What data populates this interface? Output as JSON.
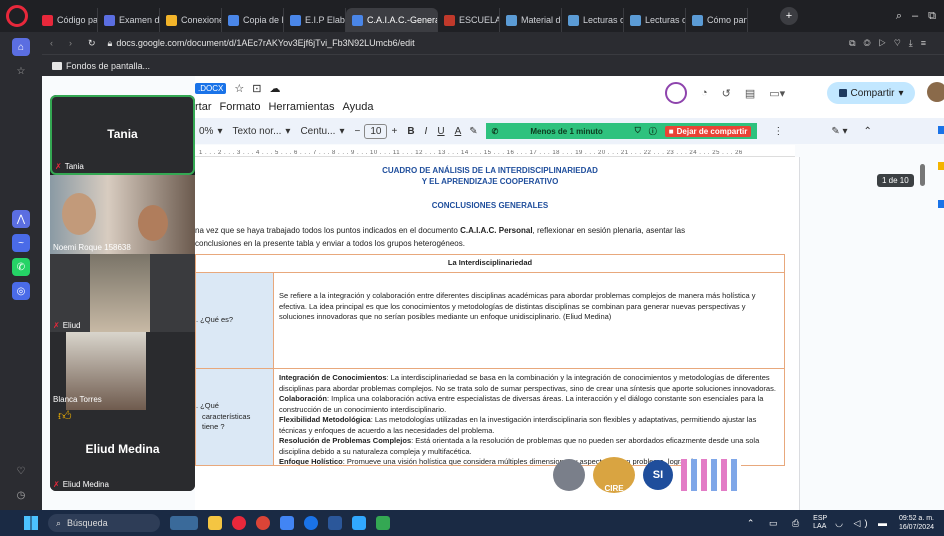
{
  "browser": {
    "tabs": [
      {
        "label": "Código para i",
        "color": "#e8283b"
      },
      {
        "label": "Examen de 2°",
        "color": "#5b6ee1"
      },
      {
        "label": "Conexiones 5°",
        "color": "#f2b42a"
      },
      {
        "label": "Copia de Roq",
        "color": "#4a86e8"
      },
      {
        "label": "E.I.P Elaborac",
        "color": "#4a86e8"
      },
      {
        "label": "C.A.I.A.C.-General.docx",
        "color": "#4a86e8"
      },
      {
        "label": "ESCUELA BEN",
        "color": "#c0392b"
      },
      {
        "label": "Material de ap",
        "color": "#5b9bd5"
      },
      {
        "label": "Lecturas oblig",
        "color": "#5b9bd5"
      },
      {
        "label": "Lecturas oblig",
        "color": "#5b9bd5"
      },
      {
        "label": "Cómo particip",
        "color": "#5b9bd5"
      }
    ],
    "url": "docs.google.com/document/d/1AEc7rAKYov3Ejf6jTvi_Fb3N92LUmcb6/edit",
    "bookmark": "Fondos de pantalla..."
  },
  "doc": {
    "file_badge": ".DOCX",
    "menu": [
      "rtar",
      "Formato",
      "Herramientas",
      "Ayuda"
    ],
    "toolbar": {
      "zoom": "0%",
      "style": "Texto nor...",
      "font": "Centu...",
      "size": "10",
      "bold": "B",
      "italic": "I",
      "underline": "U",
      "color": "A",
      "meet_time": "Menos de 1 minuto",
      "stop_share": "Dejar de compartir",
      "share": "Compartir"
    },
    "ruler_text": "1 . . . 2 . . . 3 . . . 4 . . . 5 . . . 6 . . . 7 . . . 8 . . . 9 . . . 10 . . . 11 . . . 12 . . . 13 . . . 14 . . . 15 . . . 16 . . . 17 . . . 18 . . . 19 . . . 20 . . . 21 . . . 22 . . . 23 . . . 24 . . . 25 . . . 26",
    "page_indicator": "1 de 10",
    "title_line1": "CUADRO DE ANÁLISIS DE LA INTERDISCIPLINARIEDAD",
    "title_line2": "Y  EL APRENDIZAJE COOPERATIVO",
    "subtitle": "CONCLUSIONES GENERALES",
    "intro_a": "na vez que se haya trabajado todos los puntos indicados en el documento ",
    "intro_b": "C.A.I.A.C. Personal",
    "intro_c": ", reflexionar en sesión plenaria,  asentar las",
    "intro_line2": "conclusiones en la presente tabla y enviar a todos los grupos heterogéneos.",
    "table_header": "La Interdisciplinariedad",
    "row1_label": ". ¿Qué es?",
    "row1_text": "Se refiere a la integración y colaboración entre diferentes disciplinas académicas para abordar problemas complejos de manera más holística y efectiva. La idea principal es que los conocimientos y metodologías de distintas disciplinas se combinan para generar nuevas perspectivas y soluciones innovadoras que no serían posibles mediante un enfoque unidisciplinario. (Eliud Medina)",
    "row2_label_a": ". ¿Qué",
    "row2_label_b": "características",
    "row2_label_c": "tiene ?",
    "row2_items": [
      {
        "head": "Integración de Conocimientos",
        "body": ": La interdisciplinariedad se basa en la combinación y la integración de conocimientos y metodologías de diferentes disciplinas para abordar problemas complejos. No se trata solo de sumar perspectivas, sino de crear una síntesis que aporte soluciones innovadoras."
      },
      {
        "head": "Colaboración",
        "body": ": Implica una colaboración activa entre especialistas de diversas áreas. La interacción y el diálogo constante son esenciales para la construcción de un conocimiento interdisciplinario."
      },
      {
        "head": "Flexibilidad Metodológica",
        "body": ": Las metodologías utilizadas en la investigación interdisciplinaria son flexibles y adaptativas, permitiendo ajustar las técnicas y enfoques de acuerdo a las necesidades del problema."
      },
      {
        "head": "Resolución de Problemas Complejos",
        "body": ": Está orientada a la resolución de problemas que no pueden ser abordados eficazmente desde una sola disciplina debido a su naturaleza compleja y multifacética."
      },
      {
        "head": "Enfoque Holístico",
        "body": ": Promueve una visión holística que considera múltiples dimensiones y aspectos de un problema, logrando"
      }
    ],
    "footer_logo_text": "CIRE",
    "footer_si": "SI"
  },
  "meet": {
    "participants": [
      {
        "tile_name": "Tania",
        "label": "Tania"
      },
      {
        "label": "Noemi Roque 158638"
      },
      {
        "label": "Eliud"
      },
      {
        "label": "Blanca Torres"
      },
      {
        "tile_name": "Eliud Medina",
        "label": "Eliud Medina"
      }
    ]
  },
  "taskbar": {
    "search": "Búsqueda",
    "lang_a": "ESP",
    "lang_b": "LAA",
    "time": "09:52 a. m.",
    "date": "16/07/2024"
  },
  "colors": {
    "accent_blue": "#1a73e8",
    "meet_green": "#34a853",
    "stop_red": "#ea4335",
    "table_border": "#e8a87c",
    "title_blue": "#1f4e9c"
  }
}
